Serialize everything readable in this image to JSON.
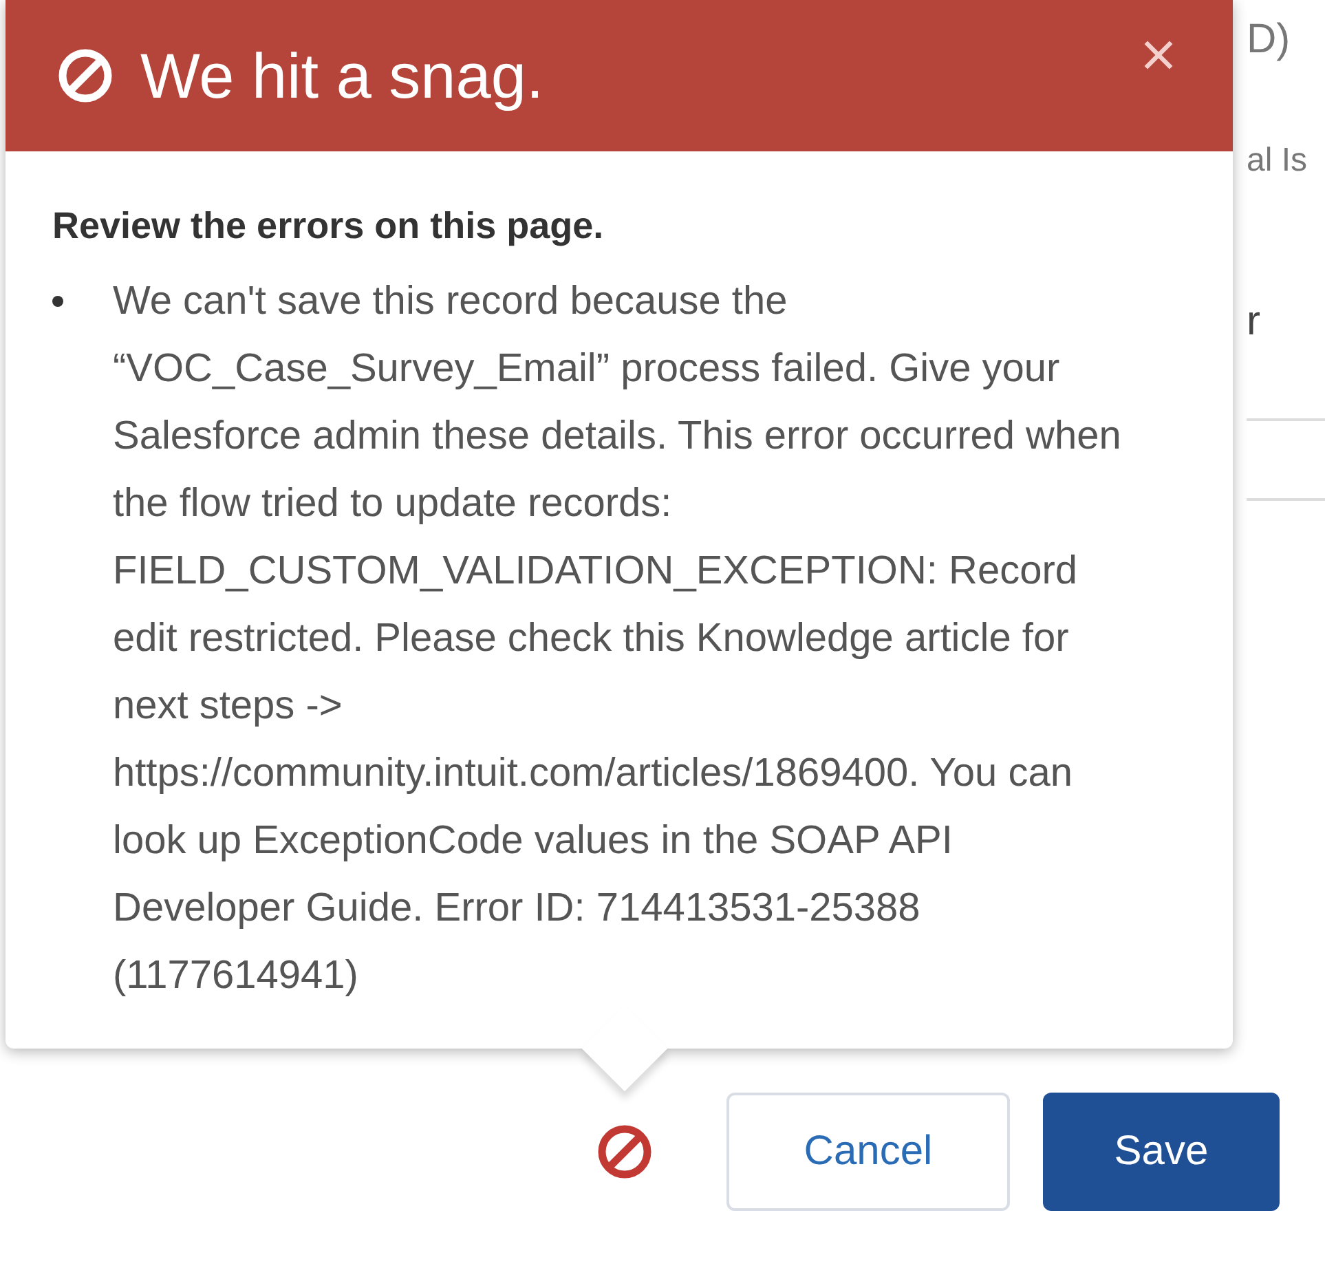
{
  "popover": {
    "title": "We hit a snag.",
    "heading": "Review the errors on this page.",
    "errors": [
      "We can't save this record because the “VOC_Case_Survey_Email” process failed. Give your Salesforce admin these details. This error occurred when the flow tried to update records: FIELD_CUSTOM_VALIDATION_EXCEPTION: Record edit restricted. Please check this Knowledge article for next steps -> https://community.intuit.com/articles/1869400. You can look up ExceptionCode values in the SOAP API Developer Guide. Error ID: 714413531-25388 (1177614941)"
    ]
  },
  "background_fragments": [
    "D)",
    "al Is",
    "r"
  ],
  "buttons": [
    {
      "label": "Cancel",
      "kind": "neutral"
    },
    {
      "label": "Save",
      "kind": "brand"
    }
  ]
}
